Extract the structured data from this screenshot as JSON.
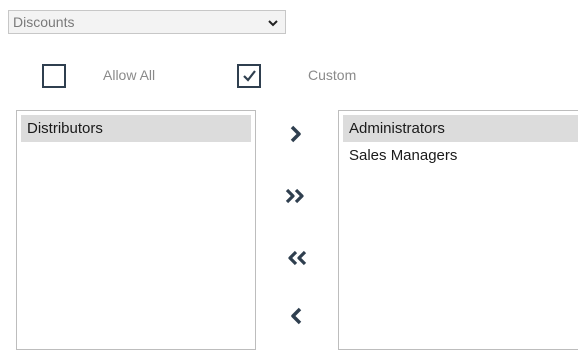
{
  "filter": {
    "selected": "Discounts"
  },
  "options": {
    "allow_all_label": "Allow All",
    "allow_all_checked": false,
    "custom_label": "Custom",
    "custom_checked": true
  },
  "available_list": {
    "items": [
      "Distributors"
    ],
    "selected_index": 0
  },
  "assigned_list": {
    "items": [
      "Administrators",
      "Sales Managers"
    ],
    "selected_index": 0
  },
  "colors": {
    "icon": "#2f3f4f",
    "selection": "#dcdcdc"
  }
}
